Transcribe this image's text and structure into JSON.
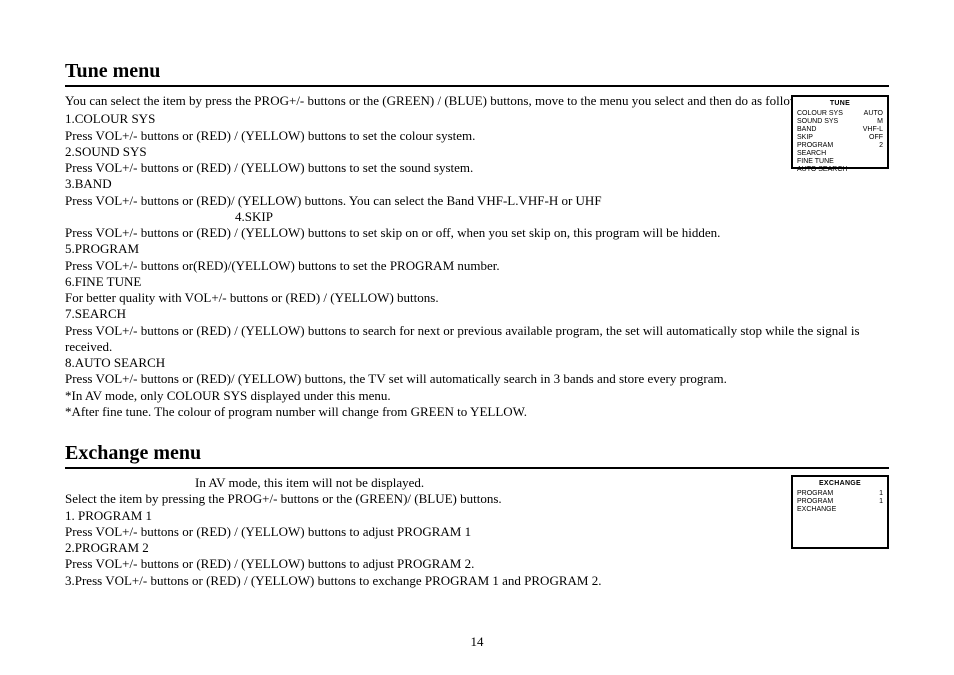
{
  "section1": {
    "title": "Tune menu",
    "intro": "You can select the item by press the PROG+/- buttons or the (GREEN) / (BLUE) buttons, move to the menu you select and then do as follows.",
    "lines": [
      "1.COLOUR SYS",
      "Press VOL+/- buttons or (RED) / (YELLOW) buttons to set the colour system.",
      "2.SOUND SYS",
      "Press VOL+/- buttons or (RED) / (YELLOW) buttons to set the sound system.",
      "3.BAND",
      "Press VOL+/- buttons or (RED)/ (YELLOW) buttons. You can select the Band VHF-L.VHF-H or UHF",
      "4.SKIP",
      "Press VOL+/- buttons or (RED) / (YELLOW) buttons to set skip on or off, when you set skip on, this program will be hidden.",
      "5.PROGRAM",
      "Press VOL+/- buttons or(RED)/(YELLOW) buttons to set the PROGRAM number.",
      "6.FINE TUNE",
      "For better quality with VOL+/- buttons or (RED) / (YELLOW) buttons.",
      "7.SEARCH",
      "Press VOL+/- buttons or (RED) / (YELLOW) buttons to search for next or previous available program, the set will automatically stop while the signal is received.",
      "8.AUTO SEARCH",
      "Press VOL+/- buttons or (RED)/ (YELLOW) buttons, the TV set will automatically search in 3 bands and store every program.",
      "*In AV mode, only COLOUR SYS displayed under this menu.",
      "*After fine tune. The colour of program number will change from GREEN to YELLOW."
    ],
    "osd": {
      "title": "TUNE",
      "rows": [
        {
          "l": "COLOUR SYS",
          "r": "AUTO"
        },
        {
          "l": "SOUND SYS",
          "r": "M"
        },
        {
          "l": "BAND",
          "r": "VHF-L"
        },
        {
          "l": "SKIP",
          "r": "OFF"
        },
        {
          "l": "PROGRAM",
          "r": "2"
        },
        {
          "l": "SEARCH",
          "r": ""
        },
        {
          "l": "FINE TUNE",
          "r": ""
        },
        {
          "l": "AUTO SEARCH",
          "r": ""
        }
      ]
    }
  },
  "section2": {
    "title": "Exchange menu",
    "note": "In AV mode, this item will not be displayed.",
    "lines": [
      "Select the item by pressing the PROG+/- buttons or the (GREEN)/ (BLUE) buttons.",
      "1. PROGRAM 1",
      "Press VOL+/- buttons or (RED) / (YELLOW) buttons to adjust PROGRAM 1",
      "2.PROGRAM 2",
      "Press VOL+/- buttons or (RED) / (YELLOW) buttons to adjust PROGRAM 2.",
      "3.Press VOL+/- buttons or (RED) / (YELLOW) buttons to exchange PROGRAM 1 and PROGRAM 2."
    ],
    "osd": {
      "title": "EXCHANGE",
      "rows": [
        {
          "l": "PROGRAM",
          "r": "1"
        },
        {
          "l": "PROGRAM",
          "r": "1"
        },
        {
          "l": "EXCHANGE",
          "r": ""
        }
      ]
    }
  },
  "page_number": "14"
}
